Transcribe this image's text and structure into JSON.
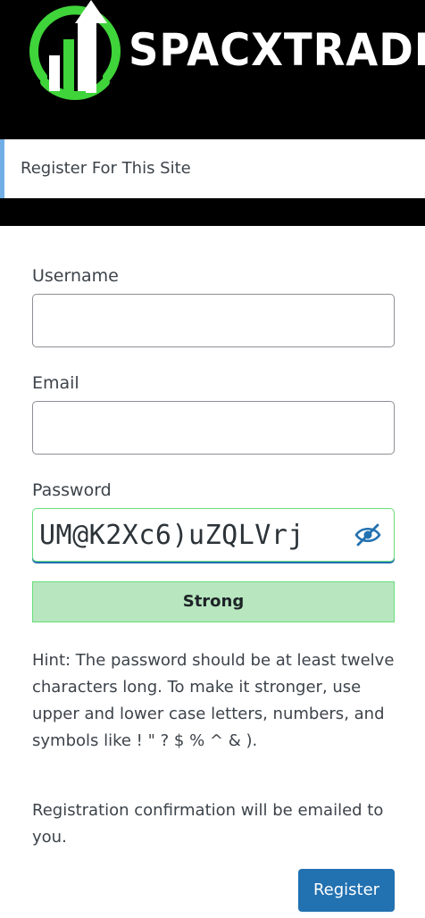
{
  "header": {
    "logo_text": "SPACXTRADE",
    "logo_icon": "chart-arrow-logo-icon",
    "colors": {
      "background": "#000000",
      "accent": "#3fd43a"
    }
  },
  "notice": {
    "text": "Register For This Site"
  },
  "form": {
    "username_label": "Username",
    "username_value": "",
    "email_label": "Email",
    "email_value": "",
    "password_label": "Password",
    "password_value": "UM@K2Xc6)uZQLVrj",
    "toggle_icon": "eye-slash-icon",
    "strength_label": "Strong",
    "hint": "Hint: The password should be at least twelve characters long. To make it stronger, use upper and lower case letters, numbers, and symbols like ! \" ? $ % ^ & ).",
    "confirmation_text": "Registration confirmation will be emailed to you.",
    "register_label": "Register"
  },
  "colors": {
    "primary": "#2271b1",
    "notice_border": "#72aee6",
    "strength_bg": "#b8e6bf",
    "strength_border": "#68de7c"
  }
}
